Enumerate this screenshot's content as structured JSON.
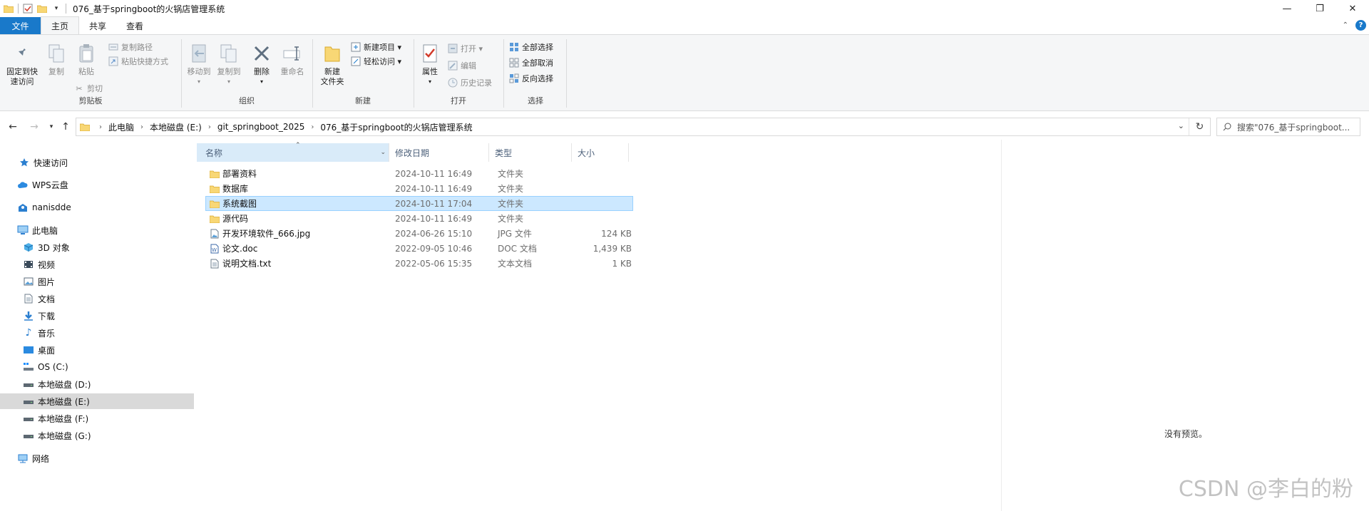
{
  "window": {
    "title": "076_基于springboot的火锅店管理系统",
    "minimize": "—",
    "restore": "❐",
    "close": "✕"
  },
  "ribbon_tabs": [
    "文件",
    "主页",
    "共享",
    "查看"
  ],
  "ribbon": {
    "clipboard": {
      "label": "剪贴板",
      "pin": "固定到快\n速访问",
      "copy": "复制",
      "paste": "粘贴",
      "copy_path": "复制路径",
      "paste_shortcut": "粘贴快捷方式",
      "cut": "剪切"
    },
    "organize": {
      "label": "组织",
      "move_to": "移动到",
      "copy_to": "复制到",
      "delete": "删除",
      "rename": "重命名"
    },
    "new": {
      "label": "新建",
      "new_folder": "新建\n文件夹",
      "new_item": "新建项目 ▾",
      "easy_access": "轻松访问 ▾"
    },
    "open": {
      "label": "打开",
      "properties": "属性",
      "open": "打开 ▾",
      "edit": "编辑",
      "history": "历史记录"
    },
    "select": {
      "label": "选择",
      "select_all": "全部选择",
      "select_none": "全部取消",
      "invert": "反向选择"
    }
  },
  "address": {
    "breadcrumbs": [
      "此电脑",
      "本地磁盘 (E:)",
      "git_springboot_2025",
      "076_基于springboot的火锅店管理系统"
    ],
    "search_placeholder": "搜索\"076_基于springboot..."
  },
  "nav_pane": [
    {
      "label": "快速访问",
      "icon": "star-icon"
    },
    {
      "label": "WPS云盘",
      "icon": "cloud-icon"
    },
    {
      "label": "nanisdde",
      "icon": "user-folder-icon"
    },
    {
      "label": "此电脑",
      "icon": "computer-icon"
    },
    {
      "label": "3D 对象",
      "icon": "3d-objects-icon"
    },
    {
      "label": "视频",
      "icon": "video-icon"
    },
    {
      "label": "图片",
      "icon": "pictures-icon"
    },
    {
      "label": "文档",
      "icon": "documents-icon"
    },
    {
      "label": "下载",
      "icon": "download-icon"
    },
    {
      "label": "音乐",
      "icon": "music-icon"
    },
    {
      "label": "桌面",
      "icon": "desktop-icon"
    },
    {
      "label": "OS (C:)",
      "icon": "os-drive-icon"
    },
    {
      "label": "本地磁盘 (D:)",
      "icon": "drive-icon"
    },
    {
      "label": "本地磁盘 (E:)",
      "icon": "drive-icon",
      "selected": true
    },
    {
      "label": "本地磁盘 (F:)",
      "icon": "drive-icon"
    },
    {
      "label": "本地磁盘 (G:)",
      "icon": "drive-icon"
    },
    {
      "label": "网络",
      "icon": "network-icon"
    }
  ],
  "columns": {
    "name": "名称",
    "date": "修改日期",
    "type": "类型",
    "size": "大小"
  },
  "files": [
    {
      "name": "部署资料",
      "date": "2024-10-11 16:49",
      "type": "文件夹",
      "size": "",
      "icon": "folder-icon"
    },
    {
      "name": "数据库",
      "date": "2024-10-11 16:49",
      "type": "文件夹",
      "size": "",
      "icon": "folder-icon"
    },
    {
      "name": "系统截图",
      "date": "2024-10-11 17:04",
      "type": "文件夹",
      "size": "",
      "icon": "folder-icon",
      "selected": true
    },
    {
      "name": "源代码",
      "date": "2024-10-11 16:49",
      "type": "文件夹",
      "size": "",
      "icon": "folder-icon"
    },
    {
      "name": "开发环境软件_666.jpg",
      "date": "2024-06-26 15:10",
      "type": "JPG 文件",
      "size": "124 KB",
      "icon": "image-file-icon"
    },
    {
      "name": "论文.doc",
      "date": "2022-09-05 10:46",
      "type": "DOC 文档",
      "size": "1,439 KB",
      "icon": "word-doc-icon"
    },
    {
      "name": "说明文档.txt",
      "date": "2022-05-06 15:35",
      "type": "文本文档",
      "size": "1 KB",
      "icon": "text-file-icon"
    }
  ],
  "preview": {
    "empty_text": "没有预览。"
  },
  "watermark": "CSDN @李白的粉",
  "colors": {
    "accent": "#1979ca",
    "folder": "#f8d775",
    "selection": "#cce8ff"
  }
}
